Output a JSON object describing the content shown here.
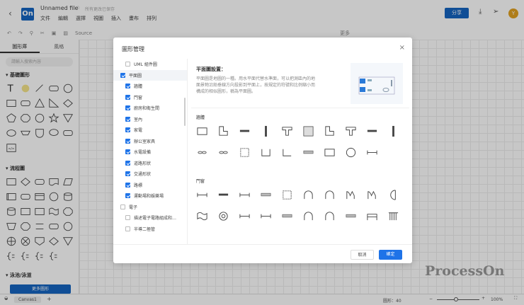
{
  "header": {
    "title": "Unnamed file",
    "saved": "所有更改已保存",
    "logo": "On",
    "menu": [
      "文件",
      "編輯",
      "選擇",
      "視圖",
      "插入",
      "畫布",
      "排列"
    ],
    "share": "分享",
    "avatar": "Y"
  },
  "toolbar": {
    "font": "Source",
    "more": "更多"
  },
  "sidebar": {
    "tabs": [
      "圖形庫",
      "風格"
    ],
    "search_placeholder": "請輸入搜索內容",
    "sections": [
      "基礎圖形",
      "流程圖",
      "泳池/泳道"
    ],
    "more_shapes": "更多圖形",
    "basic": [
      "text",
      "note",
      "arrow",
      "rrect",
      "circle",
      "rect",
      "rrect",
      "triangle",
      "rtriangle",
      "diamond",
      "pentagon",
      "octagon",
      "circle",
      "star",
      "vtriangle",
      "ellipse",
      "trapezoid",
      "drop",
      "bubble",
      "rrect",
      "code"
    ],
    "flow": [
      "rect",
      "diamond",
      "rrect",
      "doc",
      "parallelogram",
      "rect2",
      "rrect",
      "rect3",
      "circle",
      "cyl",
      "cyl",
      "rect",
      "rect",
      "wave",
      "octagon",
      "trap",
      "octagon",
      "lines",
      "rrect",
      "circle",
      "cross",
      "xcircle",
      "shield",
      "diamond",
      "vtriangle",
      "brace",
      "brace",
      "brace",
      "brace"
    ]
  },
  "bottom": {
    "canvas_tab": "Canvas1",
    "add": "+",
    "shape_count": "圖形：40",
    "zoom": "100%"
  },
  "watermark": "ProcessOn",
  "dialog": {
    "title": "圖形管理",
    "close": "×",
    "cancel": "取消",
    "confirm": "確定",
    "list": [
      {
        "label": "UML 組件圖",
        "checked": false,
        "indent": 1
      },
      {
        "label": "平面圖",
        "checked": true,
        "indent": 0,
        "selected": true
      },
      {
        "label": "牆體",
        "checked": true,
        "indent": 1
      },
      {
        "label": "門窗",
        "checked": true,
        "indent": 1
      },
      {
        "label": "廚房和衛生間",
        "checked": true,
        "indent": 1
      },
      {
        "label": "室內",
        "checked": true,
        "indent": 1
      },
      {
        "label": "家電",
        "checked": true,
        "indent": 1
      },
      {
        "label": "辦公室家具",
        "checked": true,
        "indent": 1
      },
      {
        "label": "水電設備",
        "checked": true,
        "indent": 1
      },
      {
        "label": "道路形狀",
        "checked": true,
        "indent": 1
      },
      {
        "label": "交通形狀",
        "checked": true,
        "indent": 1
      },
      {
        "label": "路標",
        "checked": true,
        "indent": 1
      },
      {
        "label": "運動場和娛樂場",
        "checked": true,
        "indent": 1
      },
      {
        "label": "電子",
        "checked": false,
        "indent": 0
      },
      {
        "label": "描述電子電路組成和…",
        "checked": false,
        "indent": 1
      },
      {
        "label": "半導二極管",
        "checked": false,
        "indent": 1
      }
    ],
    "desc_title": "平面圖設置：",
    "desc_text": "平面圖是地圖的一種。用水平面代替水準面，可以把測區內的地面景物沿鉛垂線方向投影到平面上，按規定的符號和比例縮小而構成的相似圖形，稱為平面圖。",
    "categories": [
      {
        "name": "牆體",
        "rows": [
          [
            "rect",
            "lwall",
            "hbar",
            "vbar",
            "twall",
            "hatch",
            "lwall",
            "twall",
            "hbar",
            "vbar"
          ],
          [
            "link",
            "link",
            "dashrect",
            "u",
            "l",
            "hbar2",
            "rect",
            "circle",
            "hline"
          ]
        ]
      },
      {
        "name": "門窗",
        "rows": [
          [
            "hline",
            "hbar",
            "hline",
            "hbar2",
            "dashrect",
            "arc",
            "arc",
            "m",
            "m",
            "half"
          ],
          [
            "wave",
            "ring",
            "hline",
            "hline",
            "hbar2",
            "arc",
            "arc",
            "hbar2",
            "bench",
            "grill"
          ]
        ]
      }
    ]
  }
}
